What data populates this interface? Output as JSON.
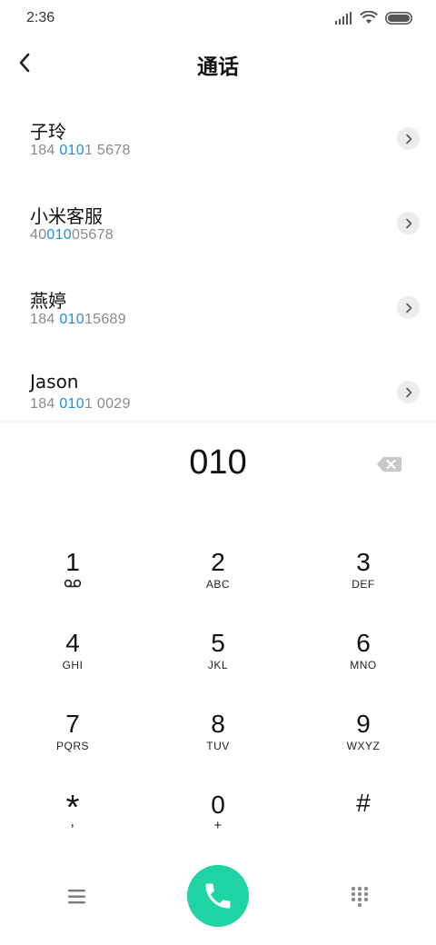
{
  "status_bar": {
    "time": "2:36",
    "icons": [
      "signal-icon",
      "wifi-icon",
      "battery-icon"
    ]
  },
  "header": {
    "title": "通话",
    "back_icon": "chevron-left-icon"
  },
  "search": {
    "query_highlight": "010"
  },
  "contacts": [
    {
      "name": "子玲",
      "number_pre": "184 ",
      "number_match": "010",
      "number_post": "1 5678"
    },
    {
      "name": "小米客服",
      "number_pre": "40",
      "number_match": "010",
      "number_post": "05678"
    },
    {
      "name": "燕婷",
      "number_pre": "184 ",
      "number_match": "010",
      "number_post": "15689"
    },
    {
      "name": "Jason",
      "number_pre": "184 ",
      "number_match": "010",
      "number_post": "1 0029"
    }
  ],
  "dialer": {
    "input": "010"
  },
  "keypad": {
    "k1": {
      "digit": "1",
      "letters": ""
    },
    "k2": {
      "digit": "2",
      "letters": "ABC"
    },
    "k3": {
      "digit": "3",
      "letters": "DEF"
    },
    "k4": {
      "digit": "4",
      "letters": "GHI"
    },
    "k5": {
      "digit": "5",
      "letters": "JKL"
    },
    "k6": {
      "digit": "6",
      "letters": "MNO"
    },
    "k7": {
      "digit": "7",
      "letters": "PQRS"
    },
    "k8": {
      "digit": "8",
      "letters": "TUV"
    },
    "k9": {
      "digit": "9",
      "letters": "WXYZ"
    },
    "kstar": {
      "digit": "*",
      "letters": ","
    },
    "k0": {
      "digit": "0",
      "letters": "+"
    },
    "khash": {
      "digit": "#",
      "letters": ""
    }
  },
  "colors": {
    "accent": "#1f8fe0",
    "call": "#1fd3a4",
    "text": "#111111",
    "secondary": "#8a8a8a"
  }
}
